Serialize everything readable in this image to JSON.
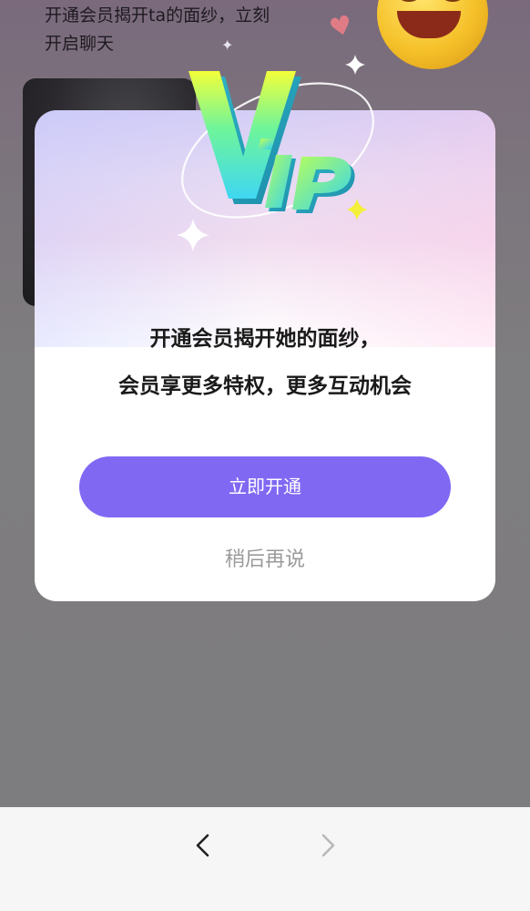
{
  "background": {
    "intro_line1": "开通会员揭开ta的面纱，立刻",
    "intro_line2": "开启聊天"
  },
  "modal": {
    "emblem_text": "VIP",
    "message_line1": "开通会员揭开她的面纱，",
    "message_line2": "会员享更多特权，更多互动机会",
    "primary_button": "立即开通",
    "secondary_button": "稍后再说"
  },
  "nav": {
    "back_icon": "chevron-left-icon",
    "forward_icon": "chevron-right-icon"
  },
  "colors": {
    "accent": "#8068f3",
    "secondary_text": "#9a9a9a",
    "overlay": "#7d7b7e",
    "bottom_bar": "#f6f6f6"
  }
}
